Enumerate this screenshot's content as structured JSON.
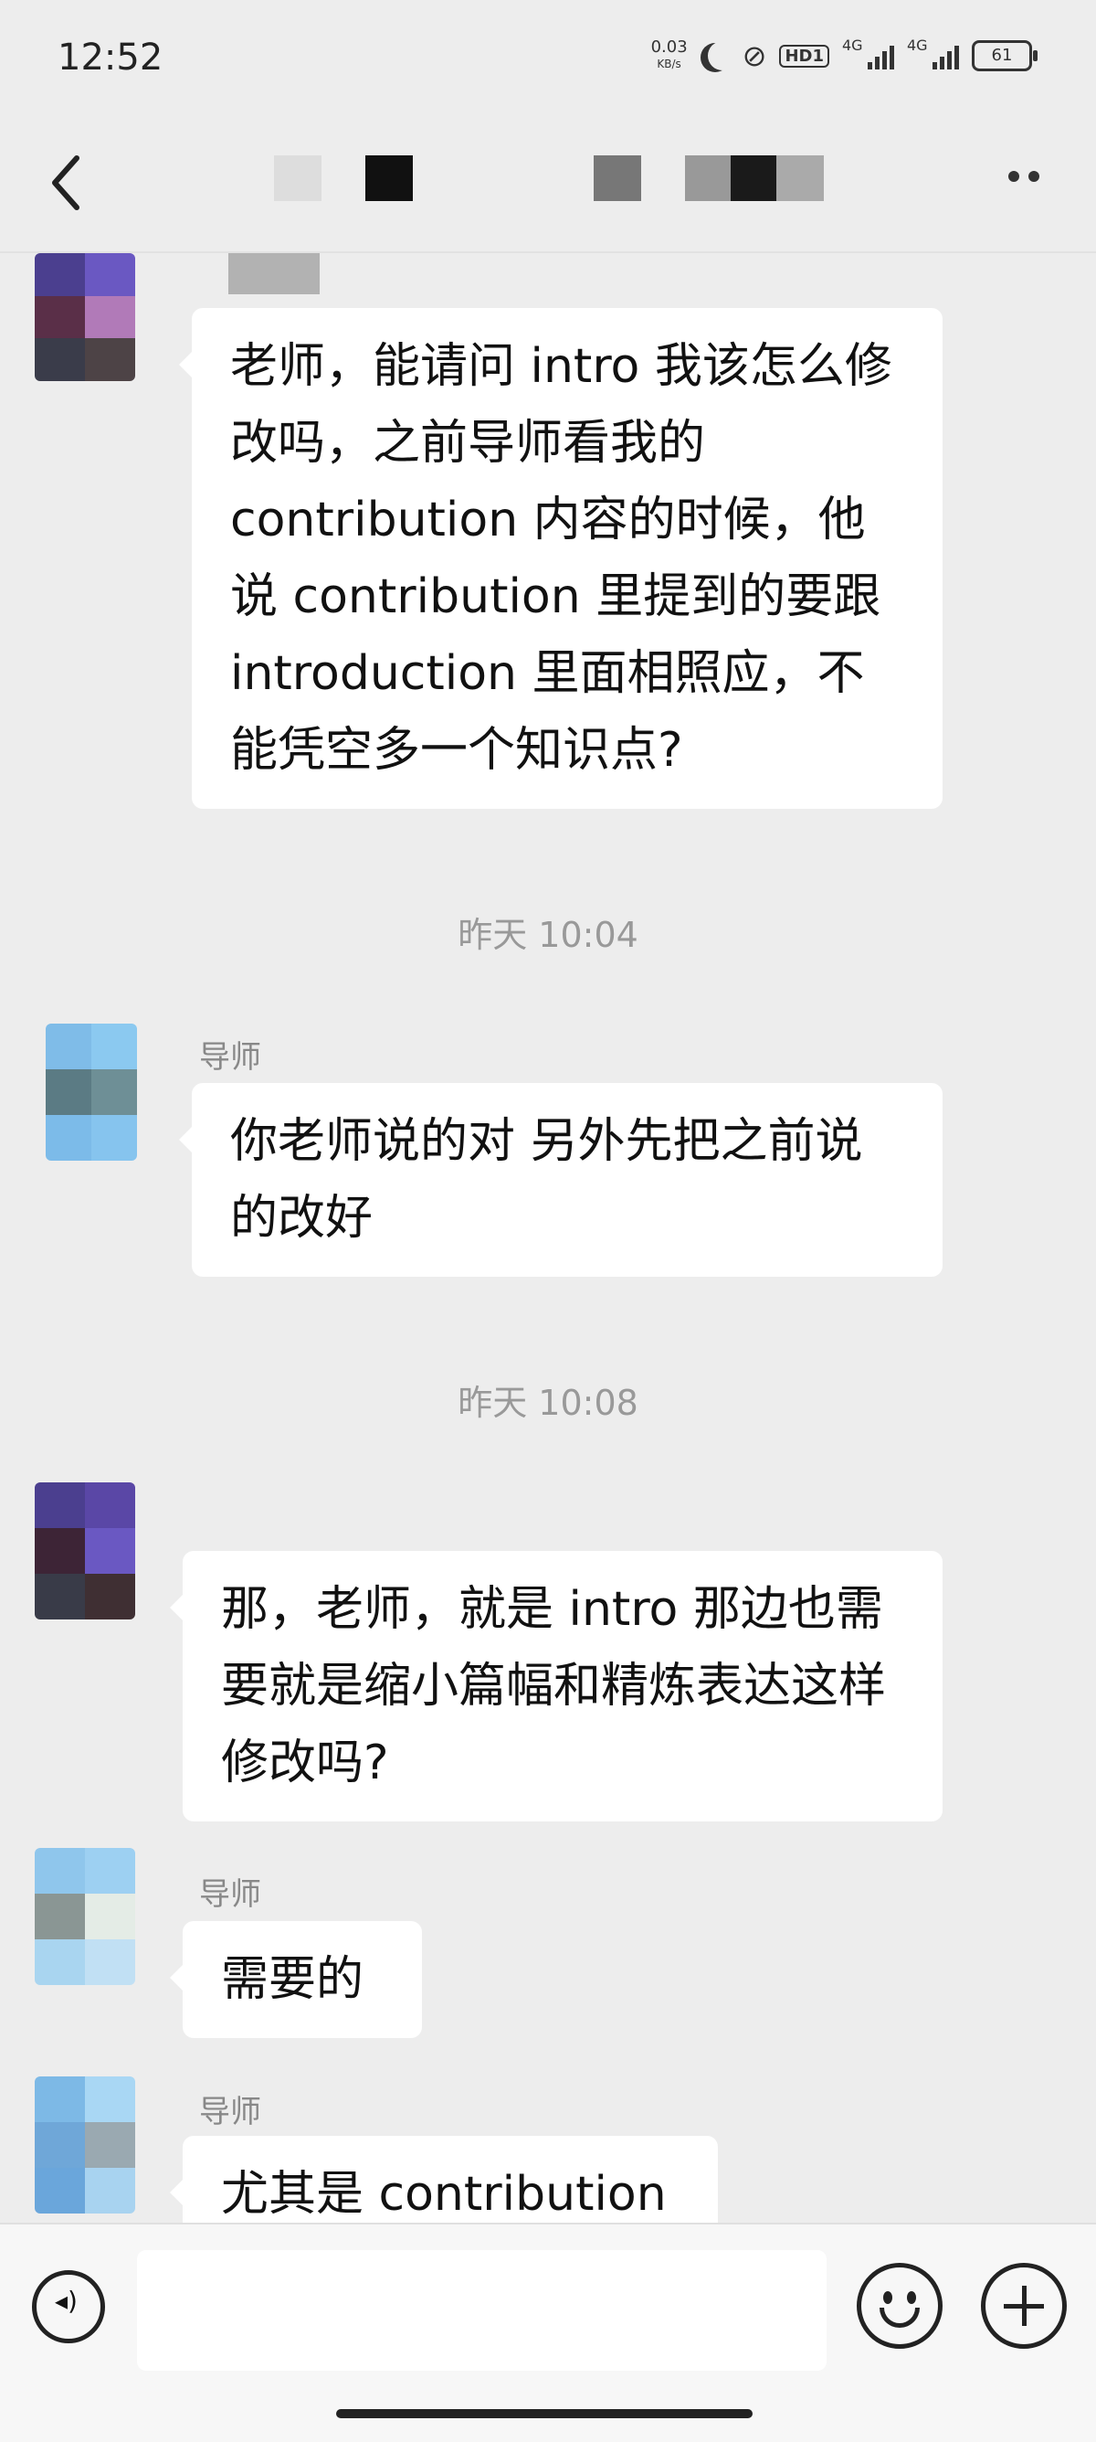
{
  "status_bar": {
    "time": "12:52",
    "net_speed": "0.03",
    "net_unit": "KB/s",
    "hd": "HD1",
    "sim1": "4G",
    "sim2": "4G",
    "battery": "61"
  },
  "nav": {
    "title_redacted": true
  },
  "messages": [
    {
      "type": "text",
      "sender": "",
      "text": "老师，能请问 intro 我该怎么修改吗，之前导师看我的 contribution 内容的时候，他说 contribution 里提到的要跟 introduction 里面相照应，不能凭空多一个知识点?"
    },
    {
      "type": "time",
      "text": "昨天 10:04"
    },
    {
      "type": "text",
      "sender": "导师",
      "text": "你老师说的对 另外先把之前说的改好"
    },
    {
      "type": "time",
      "text": "昨天 10:08"
    },
    {
      "type": "text",
      "sender": "",
      "text": "那，老师，就是 intro 那边也需要就是缩小篇幅和精炼表达这样修改吗?"
    },
    {
      "type": "text",
      "sender": "导师",
      "text": "需要的"
    },
    {
      "type": "text",
      "sender": "导师",
      "text": "尤其是 contribution"
    }
  ],
  "colors": {
    "background": "#ededed",
    "bubble": "#ffffff",
    "timestamp": "#999999"
  },
  "icons": [
    "back-icon",
    "more-icon",
    "voice-icon",
    "emoji-icon",
    "plus-icon"
  ]
}
